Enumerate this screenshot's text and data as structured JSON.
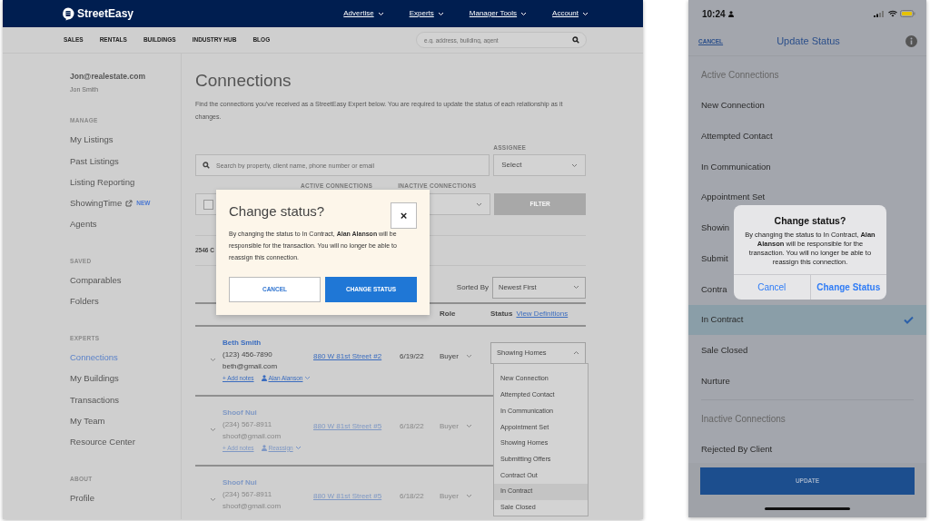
{
  "desktop": {
    "navbar": {
      "logo": "StreetEasy",
      "menus": [
        {
          "label": "Advertise"
        },
        {
          "label": "Experts"
        },
        {
          "label": "Manager Tools"
        },
        {
          "label": "Account"
        }
      ]
    },
    "subnav": {
      "links": [
        "SALES",
        "RENTALS",
        "BUILDINGS",
        "INDUSTRY HUB",
        "BLOG"
      ],
      "search": {
        "placeholder": "e.g. address, building, agent"
      }
    },
    "sidebar": {
      "email": "Jon@realestate.com",
      "name": "Jon Smith",
      "sections": [
        {
          "heading": "MANAGE",
          "items": [
            {
              "label": "My Listings",
              "selected": false
            },
            {
              "label": "Past Listings",
              "selected": false
            },
            {
              "label": "Listing Reporting",
              "selected": false
            },
            {
              "label": "ShowingTime",
              "selected": false,
              "external": true,
              "badge": "NEW"
            },
            {
              "label": "Agents",
              "selected": false
            }
          ]
        },
        {
          "heading": "SAVED",
          "items": [
            {
              "label": "Comparables",
              "selected": false
            },
            {
              "label": "Folders",
              "selected": false
            }
          ]
        },
        {
          "heading": "EXPERTS",
          "items": [
            {
              "label": "Connections",
              "selected": true
            },
            {
              "label": "My Buildings",
              "selected": false
            },
            {
              "label": "Transactions",
              "selected": false
            },
            {
              "label": "My Team",
              "selected": false
            },
            {
              "label": "Resource Center",
              "selected": false
            }
          ]
        },
        {
          "heading": "ABOUT",
          "items": [
            {
              "label": "Profile",
              "selected": false
            }
          ]
        }
      ]
    },
    "main": {
      "title": "Connections",
      "description": "Find the connections you've received as a StreetEasy Expert below. You are required to update the status of each relationship as it changes.",
      "search": {
        "placeholder": "Search by property, client name, phone number or email"
      },
      "assignee": {
        "label": "ASSIGNEE",
        "value": "Select"
      },
      "filter_checkbox": {
        "checked": false
      },
      "filter_labels": [
        "ACTIVE CONNECTIONS",
        "INACTIVE CONNECTIONS"
      ],
      "filter_button": "FILTER",
      "count": "2546 C",
      "sort": {
        "label": "Sorted By",
        "value": "Newest First"
      },
      "columns": [
        "Role",
        "Status"
      ],
      "definitions_link": "View Definitions",
      "rows": [
        {
          "name": "Beth Smith",
          "phone": "(123) 456-7890",
          "email": "beth@gmail.com",
          "address": "880 W 81st Street #2",
          "date": "6/19/22",
          "role": "Buyer",
          "status": "Showing Homes",
          "notes": "+ Add notes",
          "assignee": "Alan Alanson",
          "dim": false,
          "expanded": true
        },
        {
          "name": "Shoof Nui",
          "phone": "(234) 567-8911",
          "email": "shoof@gmail.com",
          "address": "880 W 81st Street #5",
          "date": "6/18/22",
          "role": "Buyer",
          "notes": "+ Add notes",
          "assignee": "Reassign",
          "dim": true
        },
        {
          "name": "Shoof Nui",
          "phone": "(234) 567-8911",
          "email": "shoof@gmail.com",
          "address": "880 W 81st Street #5",
          "date": "6/18/22",
          "role": "Buyer",
          "dim": true
        }
      ],
      "status_menu": [
        {
          "label": "New Connection",
          "selected": false
        },
        {
          "label": "Attempted Contact",
          "selected": false
        },
        {
          "label": "In Communication",
          "selected": false
        },
        {
          "label": "Appointment Set",
          "selected": false
        },
        {
          "label": "Showing Homes",
          "selected": false
        },
        {
          "label": "Submitting Offers",
          "selected": false
        },
        {
          "label": "Contract Out",
          "selected": false
        },
        {
          "label": "In Contract",
          "selected": true
        },
        {
          "label": "Sale Closed",
          "selected": false
        }
      ]
    },
    "modal": {
      "title": "Change status?",
      "close": "×",
      "message": "By changing the status to In Contract, **Alan Alanson** will be responsible for the transaction. You will no longer be able to reassign this connection.",
      "buttons": [
        {
          "label": "CANCEL",
          "kind": "secondary"
        },
        {
          "label": "CHANGE STATUS",
          "kind": "primary"
        }
      ]
    }
  },
  "mobile": {
    "status_bar": {
      "time": "10:24"
    },
    "header": {
      "cancel": "CANCEL",
      "title": "Update Status"
    },
    "sections": [
      {
        "heading": "Active Connections",
        "items": [
          {
            "label": "New Connection",
            "selected": false
          },
          {
            "label": "Attempted Contact",
            "selected": false
          },
          {
            "label": "In Communication",
            "selected": false
          },
          {
            "label": "Appointment Set",
            "selected": false
          },
          {
            "label": "Showin",
            "selected": false
          },
          {
            "label": "Submit",
            "selected": false
          },
          {
            "label": "Contra",
            "selected": false
          },
          {
            "label": "In Contract",
            "selected": true
          },
          {
            "label": "Sale Closed",
            "selected": false
          },
          {
            "label": "Nurture",
            "selected": false
          }
        ]
      },
      {
        "heading": "Inactive Connections",
        "items": [
          {
            "label": "Rejected By Client",
            "selected": false
          }
        ]
      }
    ],
    "update_button": "UPDATE",
    "alert": {
      "title": "Change status?",
      "message": "By changing the status to In Contract, **Alan Alanson** will be responsible for the transaction. You will no longer be able to reassign this connection.",
      "buttons": [
        {
          "label": "Cancel",
          "kind": "secondary"
        },
        {
          "label": "Change Status",
          "kind": "primary"
        }
      ]
    }
  }
}
